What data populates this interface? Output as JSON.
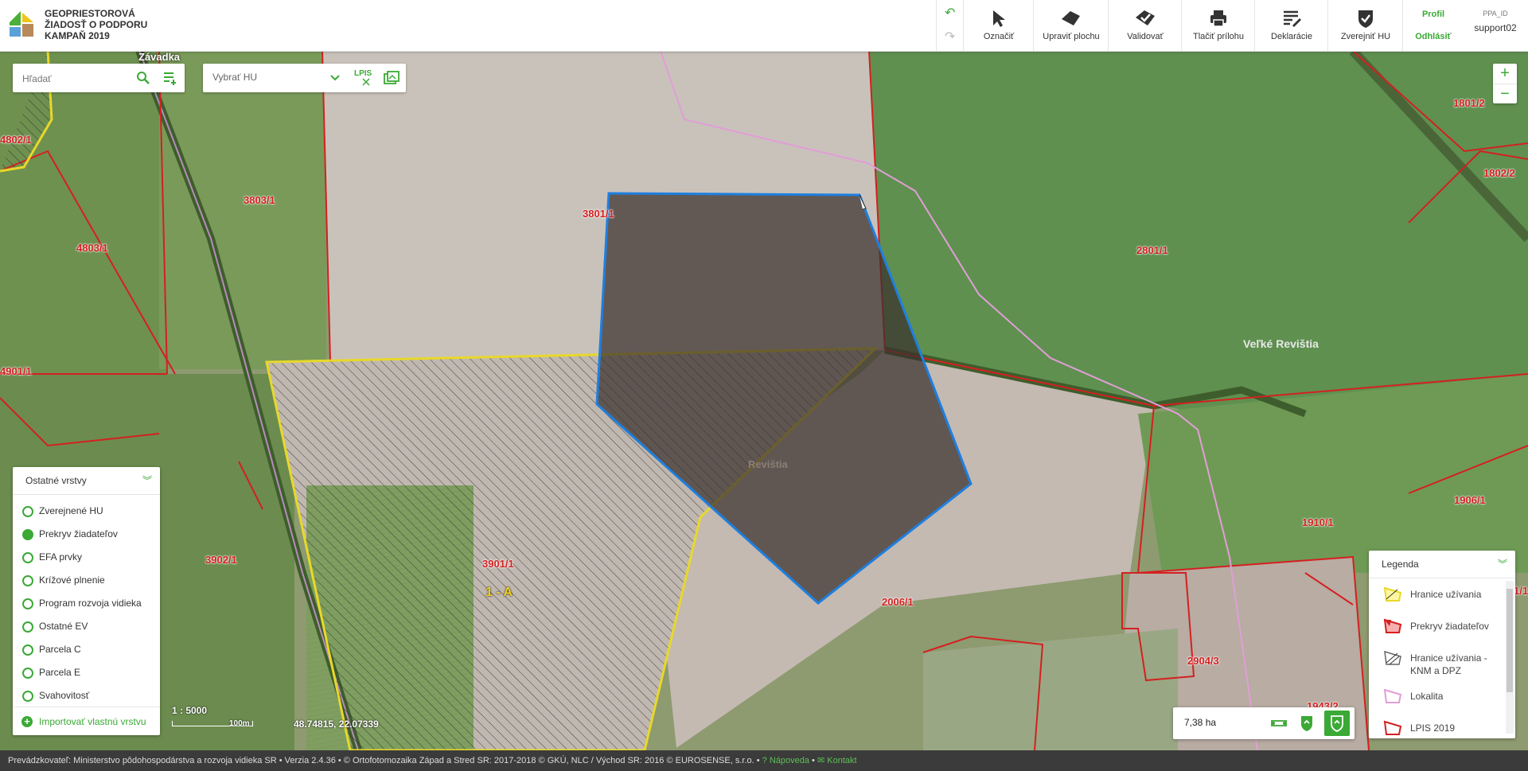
{
  "header": {
    "title_lines": [
      "GEOPRIESTOROVÁ",
      "ŽIADOSŤ O PODPORU",
      "KAMPAŇ 2019"
    ],
    "tools": [
      {
        "label": "Označiť",
        "icon": "cursor-icon"
      },
      {
        "label": "Upraviť plochu",
        "icon": "edit-area-icon"
      },
      {
        "label": "Validovať",
        "icon": "validate-icon"
      },
      {
        "label": "Tlačiť prílohu",
        "icon": "printer-icon"
      },
      {
        "label": "Deklarácie",
        "icon": "declarations-icon"
      },
      {
        "label": "Zverejniť HU",
        "icon": "publish-shield-icon"
      }
    ],
    "profile_label": "Profil",
    "logout_label": "Odhlásiť",
    "ppa_id_label": "PPA_ID",
    "username": "support02"
  },
  "search": {
    "placeholder": "Hľadať"
  },
  "hu_select": {
    "placeholder": "Vybrať HU",
    "lpis_label": "LPIS"
  },
  "layers_panel": {
    "title": "Ostatné vrstvy",
    "items": [
      {
        "label": "Zverejnené HU",
        "checked": false
      },
      {
        "label": "Prekryv žiadateľov",
        "checked": true
      },
      {
        "label": "EFA prvky",
        "checked": false
      },
      {
        "label": "Krížové plnenie",
        "checked": false
      },
      {
        "label": "Program rozvoja vidieka",
        "checked": false
      },
      {
        "label": "Ostatné EV",
        "checked": false
      },
      {
        "label": "Parcela C",
        "checked": false
      },
      {
        "label": "Parcela E",
        "checked": false
      },
      {
        "label": "Svahovitosť",
        "checked": false
      }
    ],
    "import_label": "Importovať vlastnú vrstvu"
  },
  "legend": {
    "title": "Legenda",
    "items": [
      "Hranice užívania",
      "Prekryv žiadateľov",
      "Hranice užívania - KNM a DPZ",
      "Lokalita",
      "LPIS 2019"
    ]
  },
  "map": {
    "scale": "1 : 5000",
    "scalebar_label": "100m",
    "coordinates": "48.74815, 22.07339",
    "area_value": "7,38 ha",
    "place_name": "Veľké Revištia",
    "place_name_faint": "Revištia",
    "top_label": "Závadka",
    "block_label": "1 - A",
    "parcels": [
      "4802/1",
      "3803/1",
      "4803/1",
      "3801/1",
      "2801/1",
      "1801/2",
      "1802/2",
      "4901/1",
      "3902/1",
      "3901/1",
      "2006/1",
      "1906/1",
      "1910/1",
      "2904/3",
      "1943/2",
      "1/1"
    ]
  },
  "footer": {
    "text": "Prevádzkovateľ: Ministerstvo pôdohospodárstva a rozvoja vidieka SR • Verzia 2.4.36 • © Ortofotomozaika Západ a Stred SR: 2017-2018 © GKÚ, NLC / Východ SR: 2016 © EUROSENSE, s.r.o. •",
    "help_label": "Nápoveda",
    "contact_label": "Kontakt"
  }
}
